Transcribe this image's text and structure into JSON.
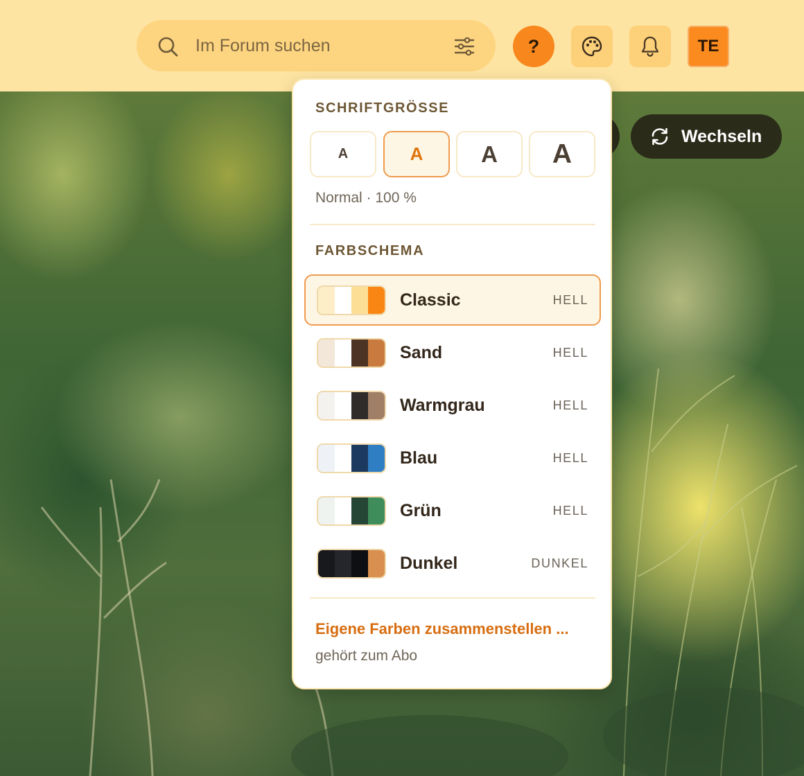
{
  "header": {
    "search": {
      "placeholder": "Im Forum suchen"
    },
    "help_label": "?",
    "avatar_initials": "TE"
  },
  "background_buttons": {
    "switch_label": "Wechseln"
  },
  "dropdown": {
    "font_size": {
      "title": "SCHRIFTGRÖSSE",
      "options": [
        {
          "label": "A",
          "selected": false
        },
        {
          "label": "A",
          "selected": true
        },
        {
          "label": "A",
          "selected": false
        },
        {
          "label": "A",
          "selected": false
        }
      ],
      "caption": "Normal · 100 %"
    },
    "color_scheme": {
      "title": "FARBSCHEMA",
      "items": [
        {
          "name": "Classic",
          "tag": "HELL",
          "selected": true,
          "colors": [
            "#fdeec8",
            "#ffffff",
            "#fcdf95",
            "#f98613"
          ]
        },
        {
          "name": "Sand",
          "tag": "HELL",
          "selected": false,
          "colors": [
            "#f3e7d9",
            "#ffffff",
            "#4d3323",
            "#c97a3f"
          ]
        },
        {
          "name": "Warmgrau",
          "tag": "HELL",
          "selected": false,
          "colors": [
            "#f4f2ef",
            "#ffffff",
            "#2f2c2a",
            "#a17f66"
          ]
        },
        {
          "name": "Blau",
          "tag": "HELL",
          "selected": false,
          "colors": [
            "#eef2f6",
            "#ffffff",
            "#1c3a5f",
            "#2f7ec4"
          ]
        },
        {
          "name": "Grün",
          "tag": "HELL",
          "selected": false,
          "colors": [
            "#eef3ef",
            "#ffffff",
            "#254535",
            "#3f8d5b"
          ]
        },
        {
          "name": "Dunkel",
          "tag": "DUNKEL",
          "selected": false,
          "colors": [
            "#17191c",
            "#24262c",
            "#0e0f12",
            "#d98f4f"
          ]
        }
      ]
    },
    "custom_colors_link": "Eigene Farben zusammenstellen ...",
    "custom_colors_note": "gehört zum Abo"
  },
  "colors": {
    "header_bg": "#fee4a2",
    "accent": "#f8871d",
    "link": "#d76d10"
  }
}
